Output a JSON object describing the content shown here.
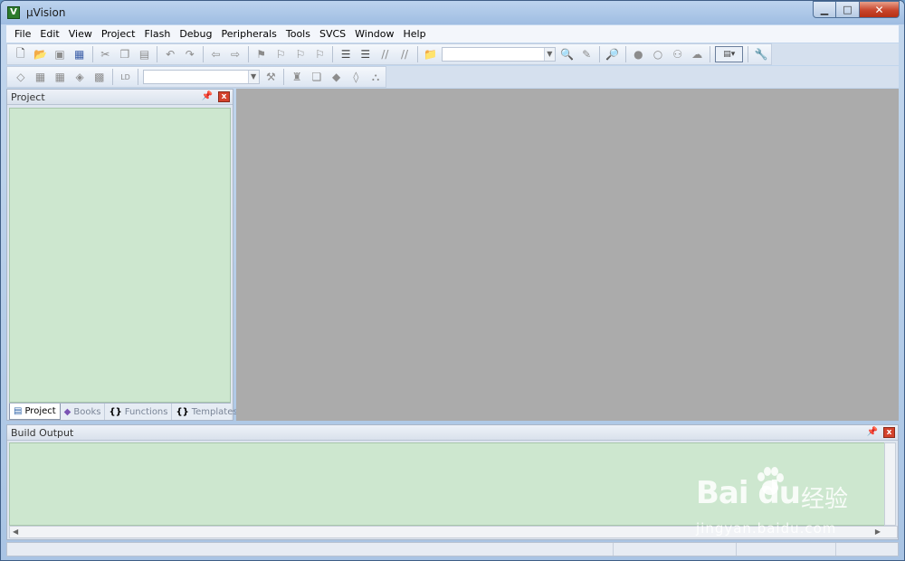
{
  "window": {
    "title": "µVision",
    "app_icon_letter": "V",
    "controls": {
      "minimize": "▁",
      "maximize": "□",
      "close": "✕"
    }
  },
  "menubar": {
    "items": [
      "File",
      "Edit",
      "View",
      "Project",
      "Flash",
      "Debug",
      "Peripherals",
      "Tools",
      "SVCS",
      "Window",
      "Help"
    ]
  },
  "toolbar1": {
    "icons": [
      "new-file-icon",
      "open-folder-icon",
      "save-icon",
      "save-all-icon",
      "cut-icon",
      "copy-icon",
      "paste-icon",
      "undo-icon",
      "redo-icon",
      "nav-back-icon",
      "nav-forward-icon",
      "bookmark-icon",
      "prev-bookmark-icon",
      "next-bookmark-icon",
      "clear-bookmarks-icon",
      "indent-icon",
      "unindent-icon",
      "comment-icon",
      "uncomment-icon",
      "find-in-files-icon",
      "find-icon",
      "incremental-find-icon",
      "debug-session-icon",
      "breakpoint-icon",
      "breakpoint-disable-icon",
      "breakpoint-all-icon",
      "kill-breakpoints-icon",
      "window-layout-icon",
      "configure-icon"
    ],
    "find_combo": ""
  },
  "toolbar2": {
    "icons": [
      "translate-icon",
      "build-icon",
      "rebuild-icon",
      "batch-build-icon",
      "stop-build-icon",
      "download-icon",
      "target-options-icon",
      "manage-components-icon",
      "select-packs-icon",
      "pack-installer-icon",
      "rte-icon"
    ],
    "target_combo": ""
  },
  "project_pane": {
    "title": "Project",
    "pin_glyph": "📌",
    "close_glyph": "x",
    "tabs": [
      {
        "label": "Project",
        "icon": "project-tab-icon",
        "glyph": "▤"
      },
      {
        "label": "Books",
        "icon": "books-tab-icon",
        "glyph": "◆"
      },
      {
        "label": "Functions",
        "icon": "functions-tab-icon",
        "glyph": "{}"
      },
      {
        "label": "Templates",
        "icon": "templates-tab-icon",
        "glyph": "{}"
      }
    ]
  },
  "build_output": {
    "title": "Build Output",
    "pin_glyph": "📌",
    "close_glyph": "x",
    "scroll_left": "◀",
    "scroll_right": "▶"
  },
  "watermark": {
    "brand": "Bai du",
    "brand_cn": "经验",
    "url": "jingyan.baidu.com"
  }
}
